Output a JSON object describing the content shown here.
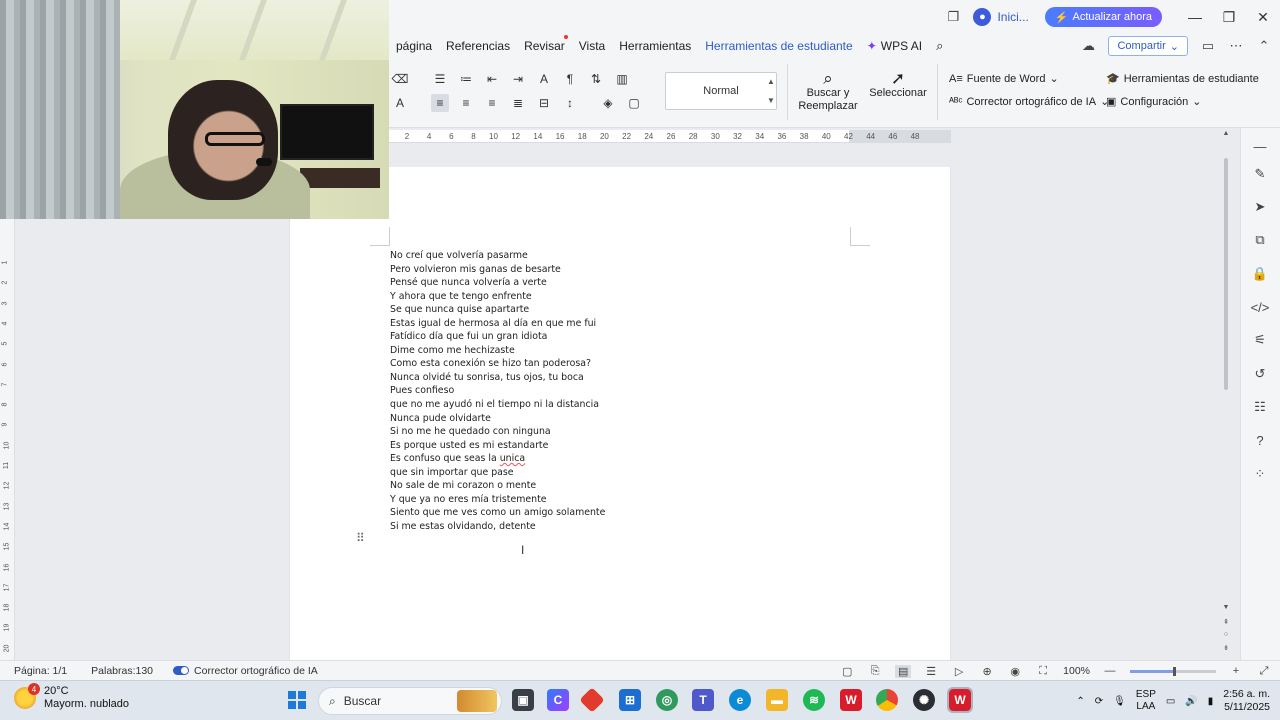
{
  "menu": {
    "items": [
      "página",
      "Referencias",
      "Revisar",
      "Vista",
      "Herramientas",
      "Herramientas de estudiante",
      "WPS AI"
    ],
    "share": "Compartir"
  },
  "topbar": {
    "account": "Inici...",
    "upgrade": "Actualizar ahora"
  },
  "toolbar": {
    "style_name": "Normal",
    "find_replace_line1": "Buscar y",
    "find_replace_line2": "Reemplazar",
    "select": "Seleccionar",
    "word_font": "Fuente de Word",
    "student_tools": "Herramientas de estudiante",
    "ai_spellcheck": "Corrector ortográfico de IA",
    "settings": "Configuración"
  },
  "ruler": {
    "numbers": [
      "2",
      "4",
      "6",
      "8",
      "10",
      "12",
      "14",
      "16",
      "18",
      "20",
      "22",
      "24",
      "26",
      "28",
      "30",
      "32",
      "34",
      "36",
      "38",
      "40",
      "42",
      "44",
      "46",
      "48"
    ]
  },
  "left_ruler": {
    "numbers": [
      "1",
      "2",
      "3",
      "4",
      "5",
      "6",
      "7",
      "8",
      "9",
      "10",
      "11",
      "12",
      "13",
      "14",
      "15",
      "16",
      "17",
      "18",
      "19",
      "20"
    ]
  },
  "document": {
    "lines": [
      "No creí que volvería pasarme",
      "Pero volvieron mis ganas de besarte",
      "Pensé que nunca volvería a verte",
      "Y ahora que te tengo enfrente",
      "Se que nunca quise apartarte",
      "Estas igual de hermosa al día en que me fui",
      "Fatídico día que fui un gran idiota",
      "Dime como me hechizaste",
      "Como esta conexión se hizo tan poderosa?",
      "Nunca olvidé tu sonrisa, tus ojos, tu boca",
      "Pues confieso",
      "que no me ayudó ni el tiempo ni la distancia",
      "Nunca pude olvidarte",
      "Si no me he quedado con ninguna",
      "Es porque usted es mi estandarte",
      "Es confuso que seas la",
      "que sin importar que pase",
      "No sale de mi corazon o mente",
      "Y que ya no eres mía tristemente",
      "Siento que me ves como un amigo solamente",
      "Si me estas olvidando, detente"
    ],
    "misspelled_word": "unica"
  },
  "status": {
    "page": "Página: 1/1",
    "words": "Palabras:130",
    "ai_spellcheck": "Corrector ortográfico de IA",
    "zoom": "100%",
    "zoom_level": 0.5
  },
  "taskbar": {
    "temp": "20°C",
    "weather": "Mayorm. nublado",
    "weather_badge": "4",
    "search_placeholder": "Buscar",
    "lang1": "ESP",
    "lang2": "LAA",
    "time": "2:56 a. m.",
    "date": "5/11/2025"
  }
}
